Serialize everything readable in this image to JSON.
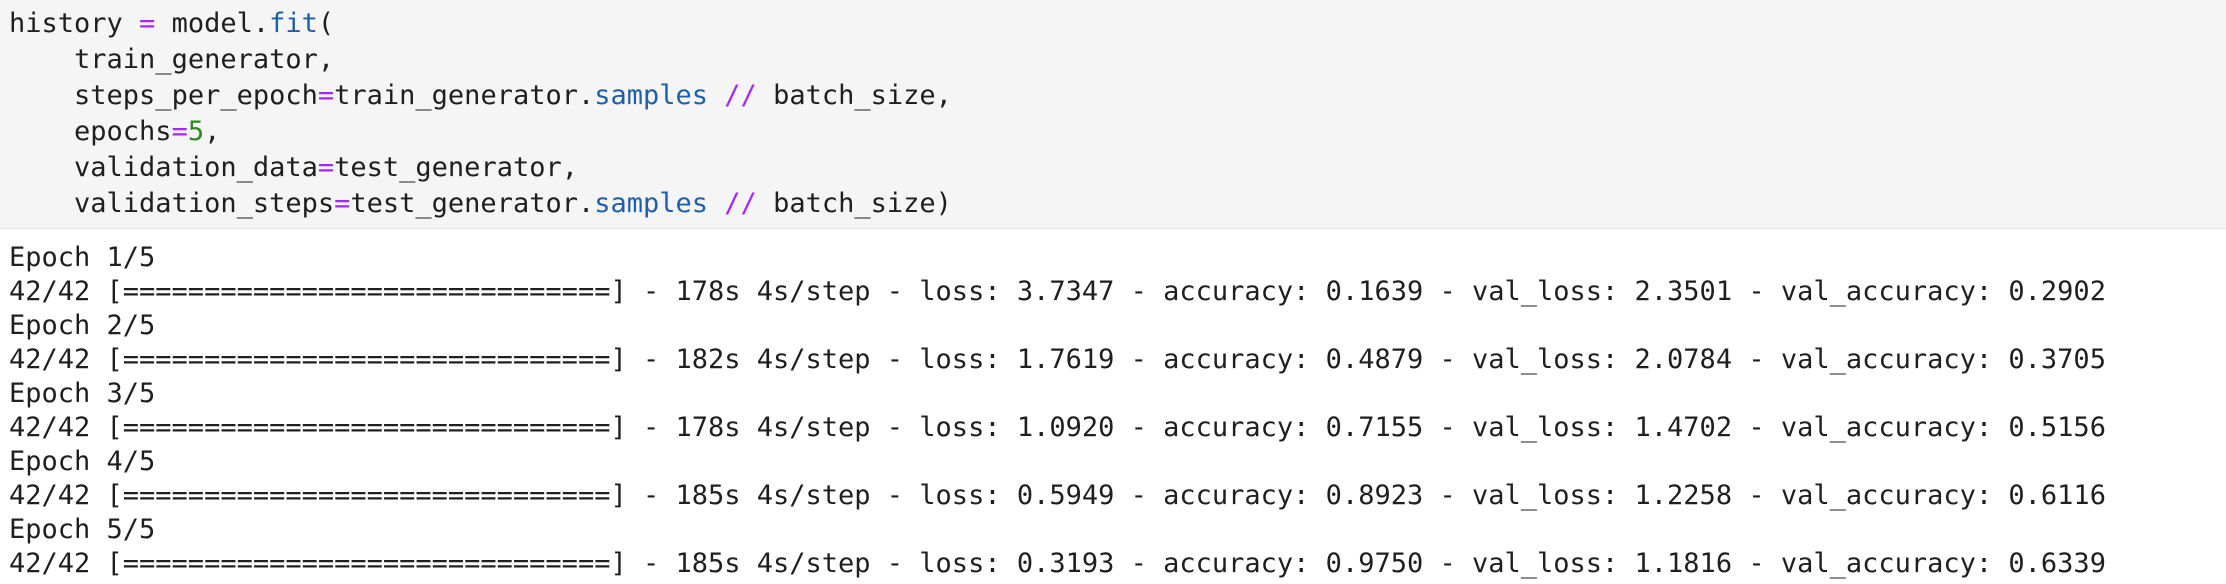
{
  "code_cell": {
    "lines": [
      {
        "indent": "",
        "tokens": [
          {
            "text": "history ",
            "kind": "plain"
          },
          {
            "text": "=",
            "kind": "op"
          },
          {
            "text": " model.",
            "kind": "plain"
          },
          {
            "text": "fit",
            "kind": "attr"
          },
          {
            "text": "(",
            "kind": "plain"
          }
        ]
      },
      {
        "indent": "    ",
        "tokens": [
          {
            "text": "train_generator,",
            "kind": "plain"
          }
        ]
      },
      {
        "indent": "    ",
        "tokens": [
          {
            "text": "steps_per_epoch",
            "kind": "plain"
          },
          {
            "text": "=",
            "kind": "op"
          },
          {
            "text": "train_generator.",
            "kind": "plain"
          },
          {
            "text": "samples",
            "kind": "attr"
          },
          {
            "text": " ",
            "kind": "plain"
          },
          {
            "text": "//",
            "kind": "op"
          },
          {
            "text": " batch_size,",
            "kind": "plain"
          }
        ]
      },
      {
        "indent": "    ",
        "tokens": [
          {
            "text": "epochs",
            "kind": "plain"
          },
          {
            "text": "=",
            "kind": "op"
          },
          {
            "text": "5",
            "kind": "num"
          },
          {
            "text": ",",
            "kind": "plain"
          }
        ]
      },
      {
        "indent": "    ",
        "tokens": [
          {
            "text": "validation_data",
            "kind": "plain"
          },
          {
            "text": "=",
            "kind": "op"
          },
          {
            "text": "test_generator,",
            "kind": "plain"
          }
        ]
      },
      {
        "indent": "    ",
        "tokens": [
          {
            "text": "validation_steps",
            "kind": "plain"
          },
          {
            "text": "=",
            "kind": "op"
          },
          {
            "text": "test_generator.",
            "kind": "plain"
          },
          {
            "text": "samples",
            "kind": "attr"
          },
          {
            "text": " ",
            "kind": "plain"
          },
          {
            "text": "//",
            "kind": "op"
          },
          {
            "text": " batch_size)",
            "kind": "plain"
          }
        ]
      }
    ],
    "colors": {
      "plain": "#1f1f1f",
      "op": "#a626f0",
      "attr": "#1f5fa8",
      "num": "#2e8a1f"
    }
  },
  "output_cell": {
    "lines": [
      "Epoch 1/5",
      "42/42 [==============================] - 178s 4s/step - loss: 3.7347 - accuracy: 0.1639 - val_loss: 2.3501 - val_accuracy: 0.2902",
      "Epoch 2/5",
      "42/42 [==============================] - 182s 4s/step - loss: 1.7619 - accuracy: 0.4879 - val_loss: 2.0784 - val_accuracy: 0.3705",
      "Epoch 3/5",
      "42/42 [==============================] - 178s 4s/step - loss: 1.0920 - accuracy: 0.7155 - val_loss: 1.4702 - val_accuracy: 0.5156",
      "Epoch 4/5",
      "42/42 [==============================] - 185s 4s/step - loss: 0.5949 - accuracy: 0.8923 - val_loss: 1.2258 - val_accuracy: 0.6116",
      "Epoch 5/5",
      "42/42 [==============================] - 185s 4s/step - loss: 0.3193 - accuracy: 0.9750 - val_loss: 1.1816 - val_accuracy: 0.6339"
    ]
  }
}
